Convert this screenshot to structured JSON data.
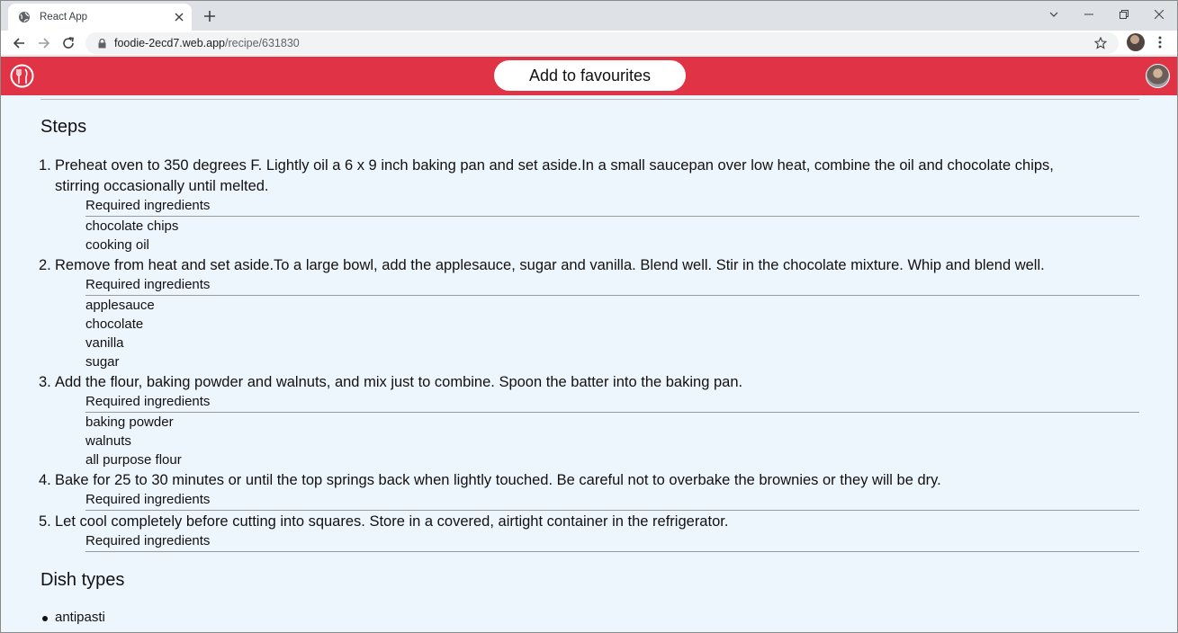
{
  "browser": {
    "tab_title": "React App",
    "url_host": "foodie-2ecd7.web.app",
    "url_path": "/recipe/631830"
  },
  "app": {
    "brand_color": "#e03345",
    "favourite_button_label": "Add to favourites"
  },
  "steps_title": "Steps",
  "required_label": "Required ingredients",
  "steps": [
    {
      "number": "1.",
      "line1": "Preheat oven to 350 degrees F. Lightly oil a 6 x 9 inch baking pan and set aside.In a small saucepan over low heat, combine the oil and chocolate chips,",
      "line2": "stirring occasionally until melted.",
      "ingredients": [
        "chocolate chips",
        "cooking oil"
      ]
    },
    {
      "number": "2.",
      "line1": "Remove from heat and set aside.To a large bowl, add the applesauce, sugar and vanilla. Blend well. Stir in the chocolate mixture. Whip and blend well.",
      "ingredients": [
        "applesauce",
        "chocolate",
        "vanilla",
        "sugar"
      ]
    },
    {
      "number": "3.",
      "line1": "Add the flour, baking powder and walnuts, and mix just to combine. Spoon the batter into the baking pan.",
      "ingredients": [
        "baking powder",
        "walnuts",
        "all purpose flour"
      ]
    },
    {
      "number": "4.",
      "line1": "Bake for 25 to 30 minutes or until the top springs back when lightly touched. Be careful not to overbake the brownies or they will be dry.",
      "ingredients": []
    },
    {
      "number": "5.",
      "line1": "Let cool completely before cutting into squares. Store in a covered, airtight container in the refrigerator.",
      "ingredients": []
    }
  ],
  "dish_types_title": "Dish types",
  "dish_types": [
    "antipasti"
  ]
}
